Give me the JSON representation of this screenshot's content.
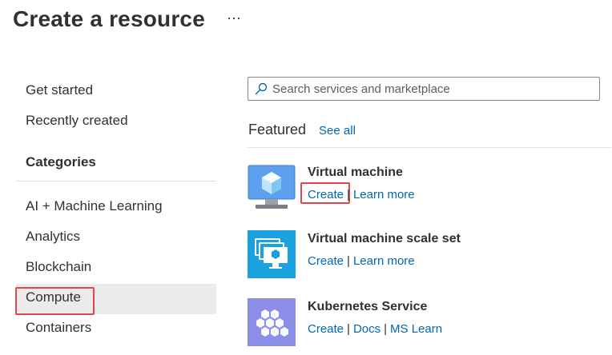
{
  "header": {
    "title": "Create a resource",
    "more_label": "···"
  },
  "sidebar": {
    "items": [
      {
        "label": "Get started"
      },
      {
        "label": "Recently created"
      }
    ],
    "categories_heading": "Categories",
    "categories": [
      {
        "label": "AI + Machine Learning"
      },
      {
        "label": "Analytics"
      },
      {
        "label": "Blockchain"
      },
      {
        "label": "Compute",
        "selected": true
      },
      {
        "label": "Containers"
      }
    ]
  },
  "search": {
    "placeholder": "Search services and marketplace",
    "icon": "search-icon"
  },
  "featured": {
    "title": "Featured",
    "see_all": "See all",
    "items": [
      {
        "name": "Virtual machine",
        "icon": "virtual-machine-icon",
        "links": [
          "Create",
          "Learn more"
        ]
      },
      {
        "name": "Virtual machine scale set",
        "icon": "vm-scale-set-icon",
        "links": [
          "Create",
          "Learn more"
        ]
      },
      {
        "name": "Kubernetes Service",
        "icon": "kubernetes-icon",
        "links": [
          "Create",
          "Docs",
          "MS Learn"
        ]
      }
    ]
  },
  "colors": {
    "link": "#0066b8",
    "highlight": "#e0474c",
    "selected_bg": "#edebe9"
  }
}
